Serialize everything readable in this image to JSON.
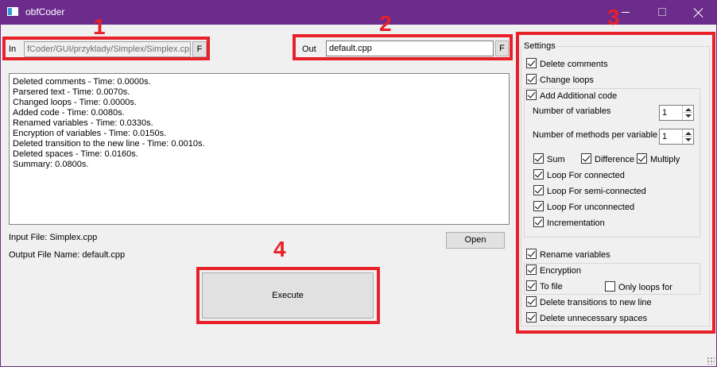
{
  "window": {
    "title": "obfCoder",
    "minimize": "—",
    "maximize": "☐",
    "close": "✕"
  },
  "annotations": [
    "1",
    "2",
    "3",
    "4"
  ],
  "input": {
    "label": "In",
    "path": "fCoder/GUI/przyklady/Simplex/Simplex.cpp",
    "browse_label": "F"
  },
  "output": {
    "label": "Out",
    "filename": "default.cpp",
    "browse_label": "F"
  },
  "log_lines": [
    "Deleted comments - Time: 0.0000s.",
    "Parsered text - Time: 0.0070s.",
    "Changed loops - Time: 0.0000s.",
    "Added code - Time: 0.0080s.",
    "Renamed variables - Time: 0.0330s.",
    "Encryption of variables - Time: 0.0150s.",
    "Deleted transition to the new line - Time: 0.0010s.",
    "Deleted spaces - Time: 0.0160s.",
    "Summary: 0.0800s."
  ],
  "info": {
    "input_file": "Input File: Simplex.cpp",
    "output_file": "Output File Name: default.cpp"
  },
  "buttons": {
    "open": "Open",
    "execute": "Execute"
  },
  "settings": {
    "title": "Settings",
    "delete_comments": "Delete comments",
    "change_loops": "Change loops",
    "add_additional_code": "Add Additional code",
    "num_variables_label": "Number of variables",
    "num_variables_value": "1",
    "num_methods_label": "Number of methods per variable",
    "num_methods_value": "1",
    "sum": "Sum",
    "difference": "Difference",
    "multiply": "Multiply",
    "loop_connected": "Loop For connected",
    "loop_semi": "Loop For semi-connected",
    "loop_unconnected": "Loop For unconnected",
    "incrementation": "Incrementation",
    "rename_variables": "Rename variables",
    "encryption": "Encryption",
    "to_file": "To file",
    "only_loops_for": "Only loops for",
    "delete_transitions": "Delete transitions to new line",
    "delete_spaces": "Delete unnecessary spaces"
  },
  "colors": {
    "titlebar": "#6c2c8c",
    "annotation_red": "#e8202a"
  }
}
